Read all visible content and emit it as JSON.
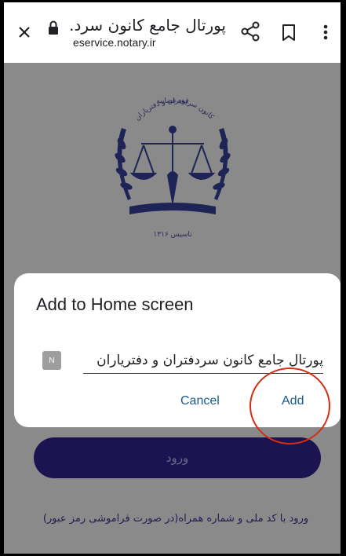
{
  "browser": {
    "page_title": "پورتال جامع کانون سرد...",
    "url": "eservice.notary.ir"
  },
  "page": {
    "logo": {
      "top_text": "قوه قضاییه",
      "arc_text": "کانون سردفتران و دفتریاران",
      "bottom_text": "تاسیس ۱۳۱۶"
    },
    "login_button_label": "ورود",
    "forgot_link": "ورود با کد ملی و شماره همراه(در صورت فراموشی رمز عبور)"
  },
  "dialog": {
    "title": "Add to Home screen",
    "icon_letter": "N",
    "name_value": "پورتال جامع کانون سردفتران و دفتریاران",
    "cancel_label": "Cancel",
    "add_label": "Add"
  },
  "colors": {
    "scrim": "#8a8a8a",
    "login_button": "#1b1450",
    "dialog_action": "#1a5a8c",
    "highlight": "#d32e14"
  },
  "icons": [
    "close-icon",
    "lock-icon",
    "share-icon",
    "bookmark-icon",
    "more-vert-icon"
  ]
}
